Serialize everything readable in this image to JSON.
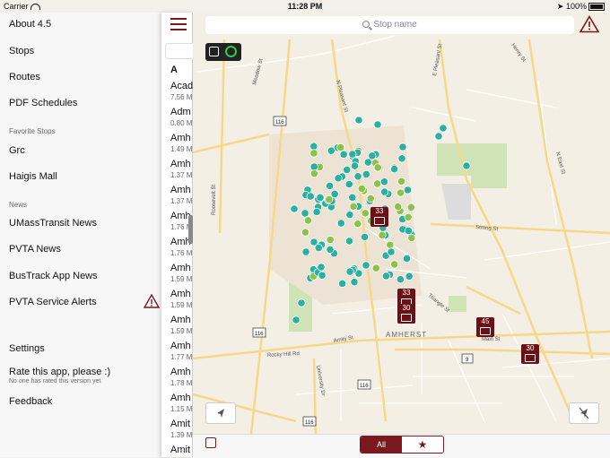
{
  "status_bar": {
    "carrier": "Carrier",
    "time": "11:28 PM",
    "battery": "100%"
  },
  "menu": {
    "about": "About 4.5",
    "stops": "Stops",
    "routes": "Routes",
    "pdf": "PDF Schedules",
    "favorite_header": "Favorite Stops",
    "fav1": "Grc",
    "fav2": "Haigis Mall",
    "news_header": "News",
    "news1": "UMassTransit News",
    "news2": "PVTA News",
    "news3": "BusTrack App News",
    "news4": "PVTA Service Alerts",
    "settings": "Settings",
    "rate": "Rate this app, please :)",
    "rate_sub": "No one has rated this version yet",
    "feedback": "Feedback"
  },
  "stop_list": {
    "section": "A",
    "stops": [
      {
        "name": "Acad",
        "dist": "7.56 M"
      },
      {
        "name": "Adm",
        "dist": "0.80 M"
      },
      {
        "name": "Amh",
        "dist": "1.49 M"
      },
      {
        "name": "Amh",
        "dist": "1.37 M"
      },
      {
        "name": "Amh",
        "dist": "1.37 M"
      },
      {
        "name": "Amh",
        "dist": "1.76 M"
      },
      {
        "name": "Amh",
        "dist": "1.76 M"
      },
      {
        "name": "Amh",
        "dist": "1.59 M"
      },
      {
        "name": "Amh",
        "dist": "1.59 M"
      },
      {
        "name": "Amh",
        "dist": "1.59 M"
      },
      {
        "name": "Amh",
        "dist": "1.77 M"
      },
      {
        "name": "Amh",
        "dist": "1.78 M"
      },
      {
        "name": "Amh",
        "dist": "1.15 M"
      },
      {
        "name": "Amit",
        "dist": "1.39 M"
      },
      {
        "name": "Amit",
        "dist": ""
      }
    ]
  },
  "search": {
    "placeholder": "Stop name"
  },
  "map": {
    "roads": {
      "meadow": "Meadow St",
      "roosevelt": "Roosevelt St",
      "n_pleasant": "N Pleasant St",
      "e_pleasant": "E Pleasant St",
      "henry": "Henry St",
      "strong": "Strong St",
      "n_east": "N East St",
      "triangle": "Triangle St",
      "main": "Main St",
      "amity": "Amity St",
      "rocky_hill": "Rocky Hill Rd",
      "university": "University Dr"
    },
    "town": "AMHERST",
    "shields": [
      "116",
      "116",
      "9",
      "116",
      "116"
    ],
    "badges": [
      "33",
      "33",
      "30",
      "45",
      "30"
    ]
  },
  "filter": {
    "all": "All",
    "favorites_glyph": "★"
  },
  "colors": {
    "accent": "#7a1a1f",
    "stop_teal": "#2ab0a0",
    "stop_green": "#8bc34a"
  }
}
